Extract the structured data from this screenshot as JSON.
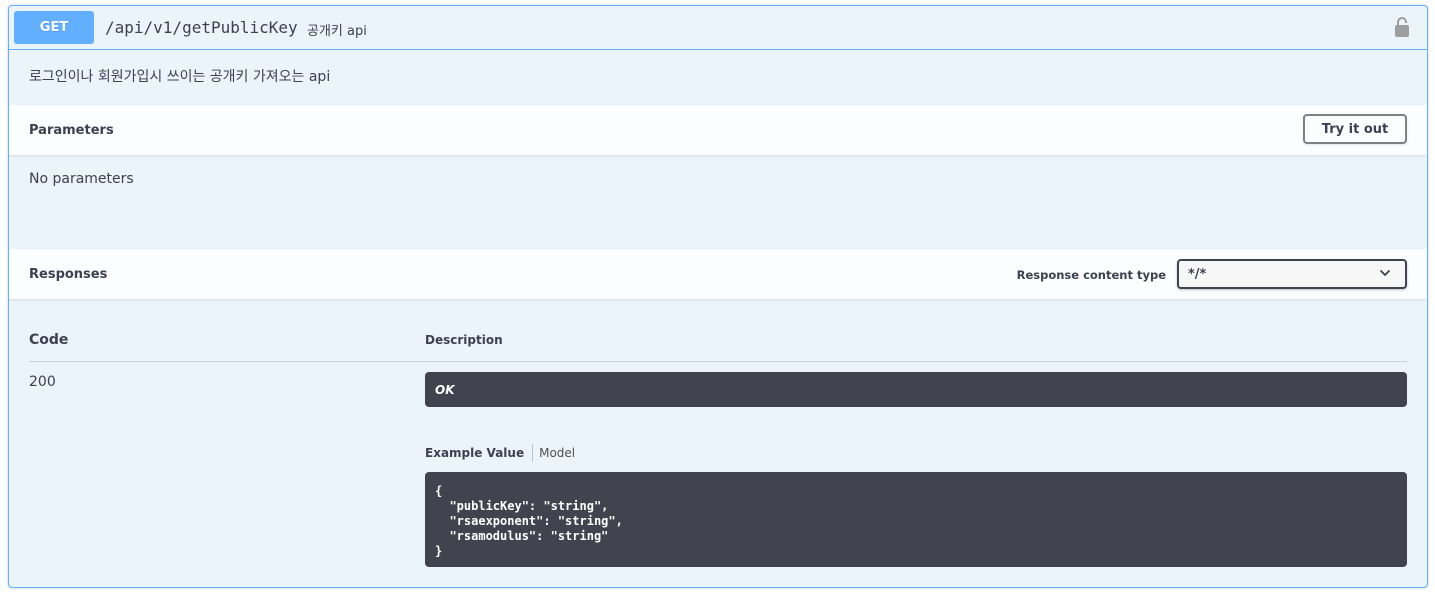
{
  "operation": {
    "method": "GET",
    "path": "/api/v1/getPublicKey",
    "summary": "공개키 api",
    "description": "로그인이나 회원가입시 쓰이는 공개키 가져오는 api",
    "lock_icon": "lock-icon"
  },
  "parameters": {
    "title": "Parameters",
    "try_button": "Try it out",
    "empty_text": "No parameters"
  },
  "responses": {
    "title": "Responses",
    "content_type_label": "Response content type",
    "content_type_value": "*/*",
    "columns": {
      "code": "Code",
      "description": "Description"
    },
    "rows": [
      {
        "code": "200",
        "description": "OK",
        "tabs": {
          "example": "Example Value",
          "model": "Model"
        },
        "example": "{\n  \"publicKey\": \"string\",\n  \"rsaexponent\": \"string\",\n  \"rsamodulus\": \"string\"\n}"
      }
    ]
  },
  "colors": {
    "get_blue": "#61affe",
    "block_bg": "#ebf3fb",
    "dark": "#41444e",
    "text": "#3b4151"
  }
}
